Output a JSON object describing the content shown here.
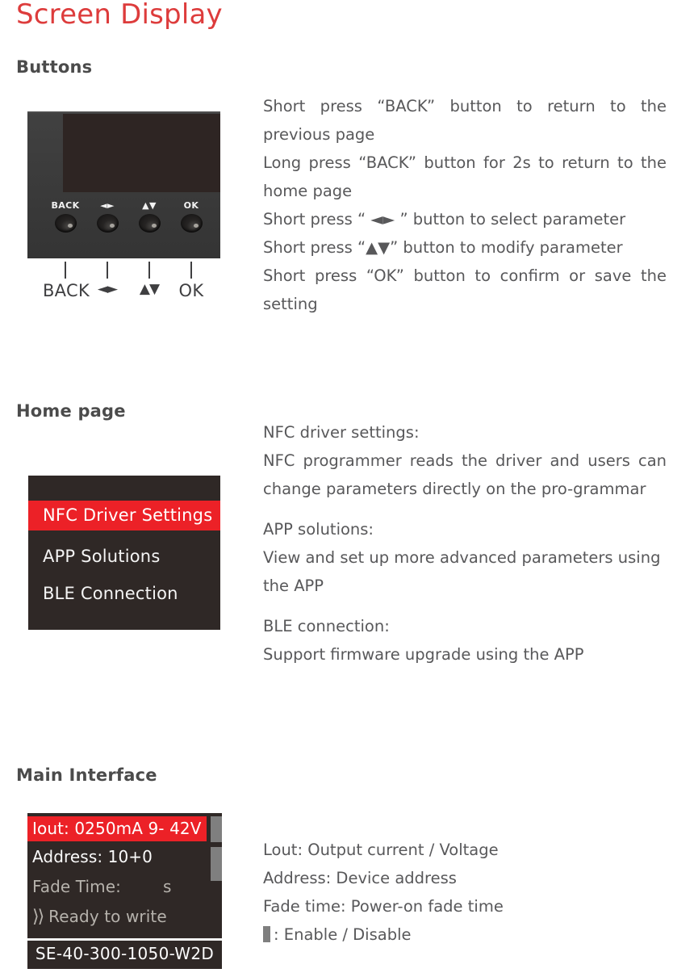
{
  "page": {
    "title": "Screen Display",
    "title_color": "#dd3c3c",
    "accent_red": "#ec2127",
    "lcd_background": "#2f2826",
    "heading_color": "#4b4b4b",
    "body_text_color": "#58585a"
  },
  "sections": {
    "buttons": {
      "heading": "Buttons",
      "device": {
        "button_caps": [
          "BACK",
          "◄►",
          "▲▼",
          "OK"
        ],
        "callout_labels": [
          "BACK",
          "◄►",
          "▲▼",
          "OK"
        ]
      },
      "description": [
        "Short press “BACK” button to return to the previous page",
        "Long press “BACK” button for 2s to return to the home page",
        "Short press “ ◄► ” button to select parameter",
        "Short press “▲▼” button to modify parameter",
        "Short press “OK” button to confirm or save the setting"
      ]
    },
    "home_page": {
      "heading": "Home page",
      "menu": [
        {
          "label": "NFC Driver Settings",
          "selected": true
        },
        {
          "label": "APP Solutions",
          "selected": false
        },
        {
          "label": "BLE Connection",
          "selected": false
        }
      ],
      "description": [
        {
          "title": "NFC driver settings:",
          "body": "NFC programmer reads the driver and users can change parameters directly on the pro-grammar"
        },
        {
          "title": "APP solutions:",
          "body": "View and set up more advanced parameters using the APP"
        },
        {
          "title": "BLE connection:",
          "body": "Support firmware upgrade using the APP"
        }
      ]
    },
    "main_interface": {
      "heading": "Main Interface",
      "screen": {
        "iout_row": "Iout: 0250mA  9- 42V",
        "address_row": "Address: 10+0",
        "fade_label": "Fade Time:",
        "fade_unit": "s",
        "status_chevron": "⟩⟩",
        "status_text": "Ready to write",
        "model": "SE-40-300-1050-W2D",
        "scrollbar_color": "#7f7f7f"
      },
      "legend": [
        "Lout: Output current / Voltage",
        "Address: Device address",
        "Fade time: Power-on fade time"
      ],
      "legend_swatch_line": ": Enable / Disable"
    }
  }
}
